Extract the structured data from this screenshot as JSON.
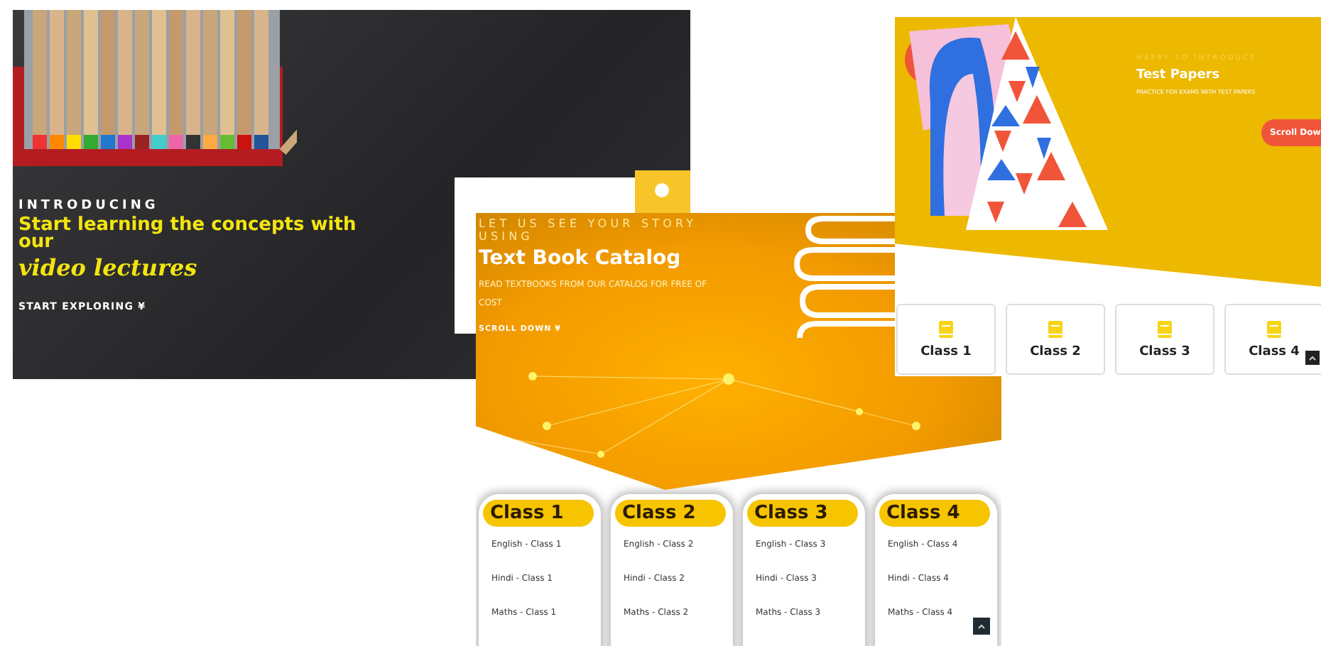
{
  "video_page": {
    "eyebrow": "INTRODUCING",
    "headline": "Start learning the concepts with our",
    "highlight": "video lectures",
    "cta": "START EXPLORING ¥"
  },
  "test_papers_page": {
    "eyebrow": "HAPPY TO INTRODUCE",
    "title": "Test Papers",
    "subtitle": "PRACTICE FOR EXAMS WITH TEST PAPERS",
    "cta": "Scroll Dow",
    "classes": [
      "Class 1",
      "Class 2",
      "Class 3",
      "Class 4"
    ]
  },
  "catalog_page": {
    "eyebrow": "LET US SEE YOUR STORY USING",
    "title": "Text Book Catalog",
    "subtitle": "READ TEXTBOOKS FROM OUR CATALOG FOR FREE OF COST",
    "cta": "SCROLL DOWN ¥",
    "classes": [
      {
        "title": "Class 1",
        "subjects": [
          "English - Class 1",
          "Hindi - Class 1",
          "Maths - Class 1"
        ]
      },
      {
        "title": "Class 2",
        "subjects": [
          "English - Class 2",
          "Hindi - Class 2",
          "Maths - Class 2"
        ]
      },
      {
        "title": "Class 3",
        "subjects": [
          "English - Class 3",
          "Hindi - Class 3",
          "Maths - Class 3"
        ]
      },
      {
        "title": "Class 4",
        "subjects": [
          "English - Class 4",
          "Hindi - Class 4",
          "Maths - Class 4"
        ]
      }
    ]
  }
}
